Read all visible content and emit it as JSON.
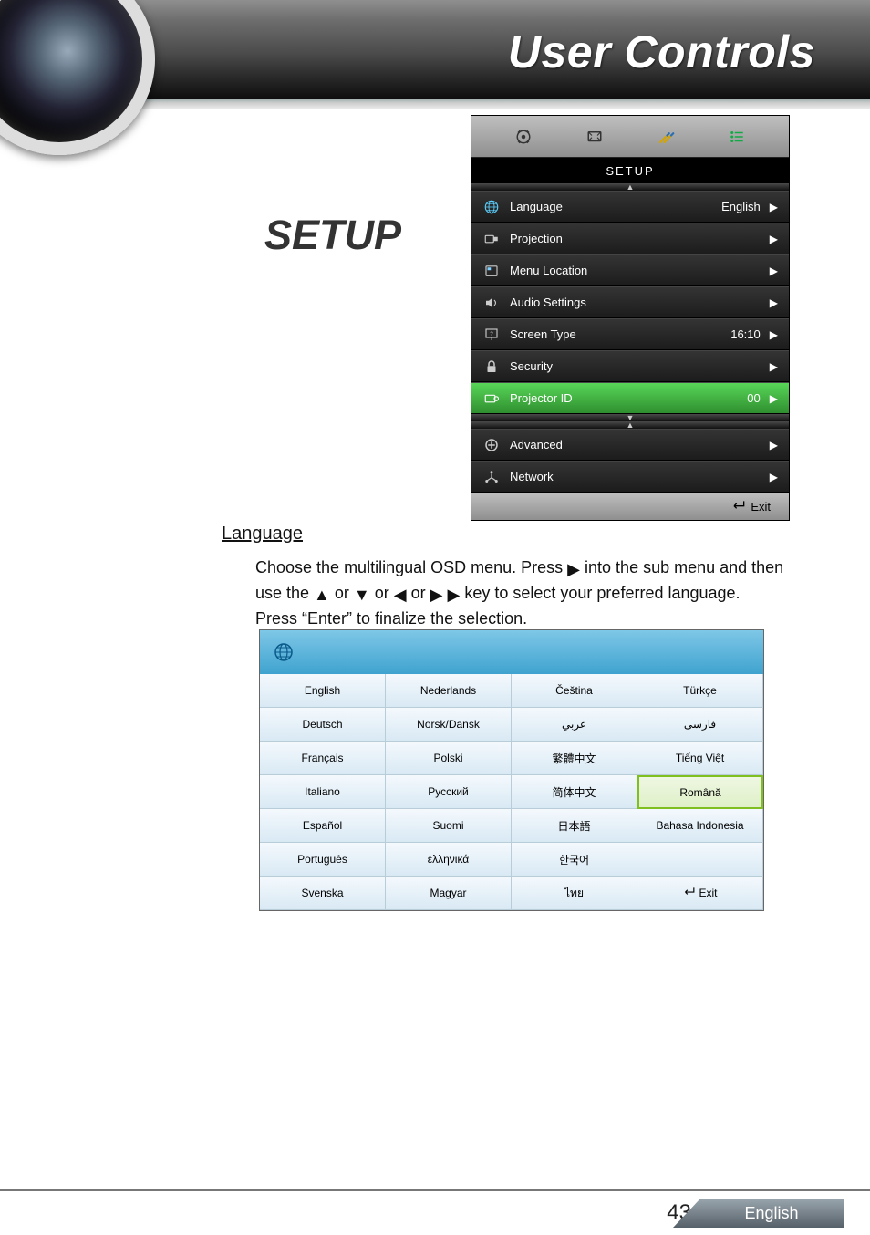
{
  "header": {
    "title": "User Controls"
  },
  "section": {
    "title": "SETUP"
  },
  "osd": {
    "title": "SETUP",
    "rows": [
      {
        "label": "Language",
        "value": "English",
        "active": false
      },
      {
        "label": "Projection",
        "value": "",
        "active": false
      },
      {
        "label": "Menu Location",
        "value": "",
        "active": false
      },
      {
        "label": "Audio Settings",
        "value": "",
        "active": false
      },
      {
        "label": "Screen Type",
        "value": "16:10",
        "active": false
      },
      {
        "label": "Security",
        "value": "",
        "active": false
      },
      {
        "label": "Projector ID",
        "value": "00",
        "active": true
      }
    ],
    "rows2": [
      {
        "label": "Advanced",
        "value": ""
      },
      {
        "label": "Network",
        "value": ""
      }
    ],
    "exit_label": "Exit"
  },
  "language_section": {
    "heading": "Language",
    "para_a": "Choose the multilingual OSD menu. Press ",
    "para_b": " into the sub menu and then use the ",
    "para_c": " or  ",
    "para_d": " or ",
    "para_e": " or ",
    "para_f": "key to select your preferred language. Press “Enter” to finalize the selection."
  },
  "language_grid": {
    "cols": [
      [
        "English",
        "Deutsch",
        "Français",
        "Italiano",
        "Español",
        "Português",
        "Svenska"
      ],
      [
        "Nederlands",
        "Norsk/Dansk",
        "Polski",
        "Русский",
        "Suomi",
        "ελληνικά",
        "Magyar"
      ],
      [
        "Čeština",
        "عربي",
        "繁體中文",
        "简体中文",
        "日本語",
        "한국어",
        "ไทย"
      ],
      [
        "Türkçe",
        "فارسی",
        "Tiếng Việt",
        "Română",
        "Bahasa Indonesia",
        "",
        "Exit"
      ]
    ],
    "selected": {
      "col": 3,
      "row": 3
    },
    "exit_label": "Exit"
  },
  "footer": {
    "page_number": "43",
    "language": "English"
  }
}
